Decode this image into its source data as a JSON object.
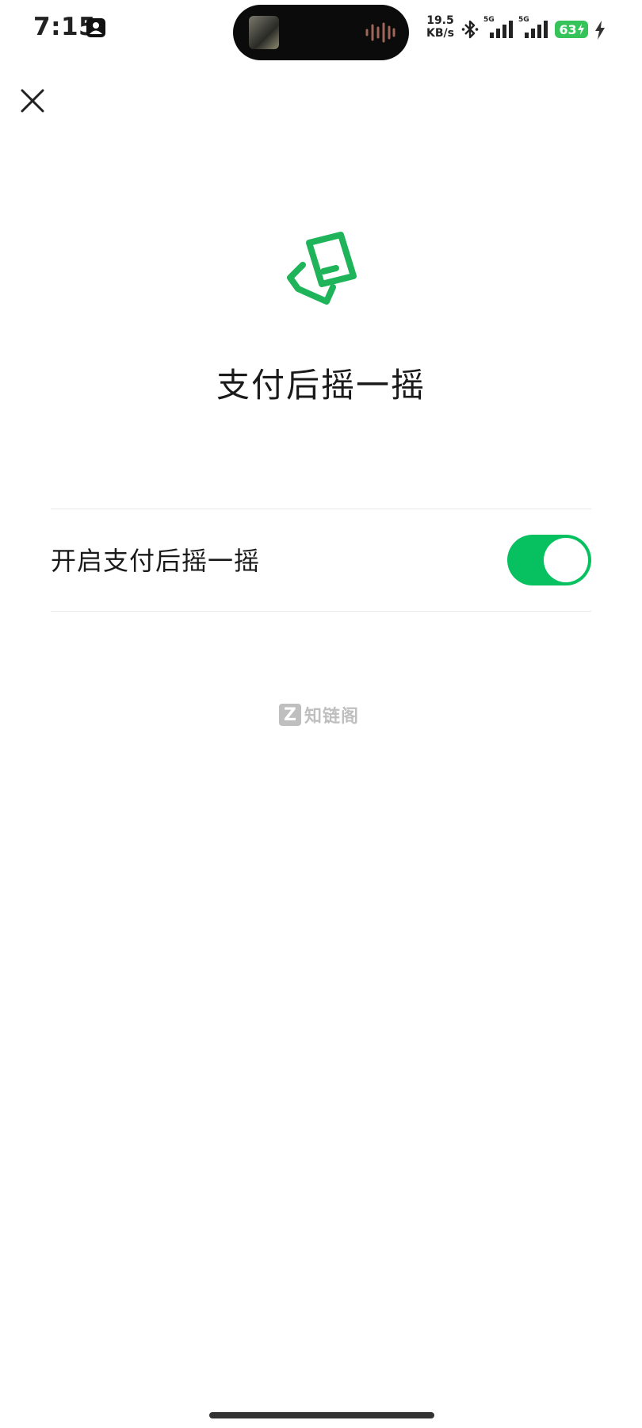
{
  "status_bar": {
    "time": "7:15",
    "net_speed_value": "19.5",
    "net_speed_unit": "KB/s",
    "sim1_label": "5G",
    "sim2_label": "5G",
    "battery": "63"
  },
  "page": {
    "title": "支付后摇一摇",
    "setting_label": "开启支付后摇一摇",
    "toggle_on": true
  },
  "watermark": {
    "logo_letter": "Z",
    "text": "知链阁"
  },
  "colors": {
    "accent": "#07c160",
    "icon_green": "#1fb35a",
    "divider": "#e9e9e9"
  }
}
